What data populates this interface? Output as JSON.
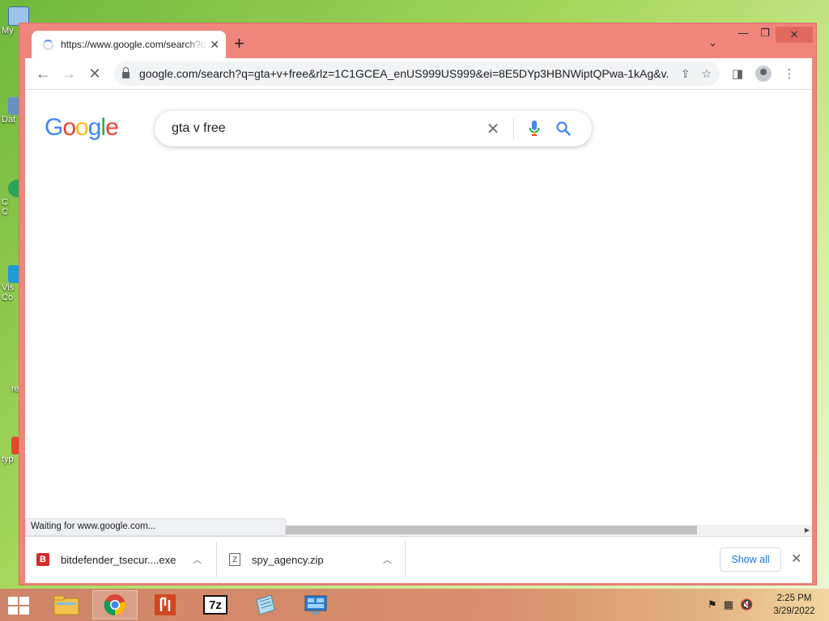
{
  "desktop": {
    "icons": [
      {
        "label": "My",
        "icon": "computer-icon"
      },
      {
        "label": "Dat",
        "icon": "database-icon"
      },
      {
        "label": "C\nC",
        "icon": "app-icon"
      },
      {
        "label": "Vis\nCo",
        "icon": "vscode-icon"
      },
      {
        "label": "re",
        "icon": "recycle-icon"
      },
      {
        "label": "typ",
        "icon": "file-icon"
      }
    ]
  },
  "browser": {
    "tab": {
      "title": "https://www.google.com/search?q=gta+v+free",
      "close": "✕"
    },
    "new_tab": "+",
    "window_controls": {
      "minimize": "—",
      "maximize": "❐",
      "close": "✕",
      "tab_search": "⌄"
    },
    "toolbar": {
      "back": "←",
      "forward": "→",
      "stop": "✕",
      "url_host": "google.com",
      "url_rest": "/search?q=gta+v+free&rlz=1C1GCEA_enUS999US999&ei=8E5DYp3HBNWiptQPwa-1kAg&v...",
      "share": "⇪",
      "bookmark": "☆",
      "sidepanel": "◨",
      "menu": "⋮"
    }
  },
  "google": {
    "logo_letters": [
      {
        "ch": "G",
        "color": "#4285F4"
      },
      {
        "ch": "o",
        "color": "#EA4335"
      },
      {
        "ch": "o",
        "color": "#FBBC05"
      },
      {
        "ch": "g",
        "color": "#4285F4"
      },
      {
        "ch": "l",
        "color": "#34A853"
      },
      {
        "ch": "e",
        "color": "#EA4335"
      }
    ],
    "search_query": "gta v free",
    "clear": "✕"
  },
  "status_bar": {
    "text": "Waiting for www.google.com..."
  },
  "downloads": {
    "items": [
      {
        "name": "bitdefender_tsecur....exe",
        "icon_letter": "B"
      },
      {
        "name": "spy_agency.zip",
        "icon_letter": "Z"
      }
    ],
    "show_all": "Show all",
    "close": "✕"
  },
  "taskbar": {
    "apps": [
      "file-explorer-icon",
      "chrome-icon",
      "pdf-reader-icon",
      "7zip-icon",
      "notepad-icon",
      "control-panel-icon"
    ],
    "sevenzip_label": "7z",
    "clock": {
      "time": "2:25 PM",
      "date": "3/29/2022"
    }
  }
}
